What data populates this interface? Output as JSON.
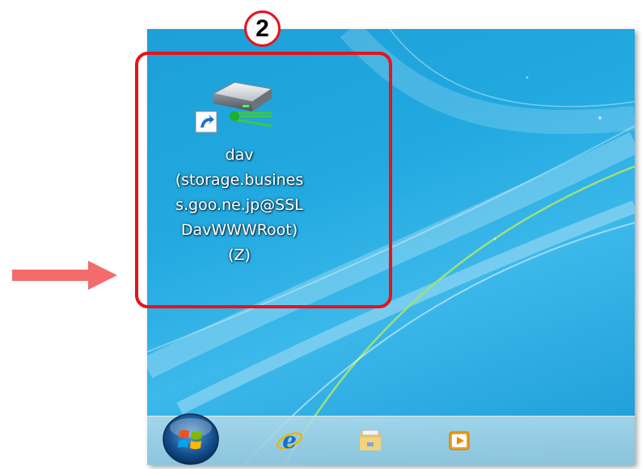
{
  "annotation": {
    "step_number": "2",
    "accent_color": "#e8121b",
    "arrow_color": "#f36b6b"
  },
  "desktop_icon": {
    "icon": "network-drive-icon",
    "label_lines": [
      "dav",
      "(storage.busines",
      "s.goo.ne.jp@SSL",
      "DavWWWRoot)",
      "(Z)"
    ]
  },
  "taskbar": {
    "start_button": "windows-start-orb-icon",
    "pinned": [
      "internet-explorer-icon",
      "file-explorer-icon",
      "media-player-icon"
    ]
  }
}
